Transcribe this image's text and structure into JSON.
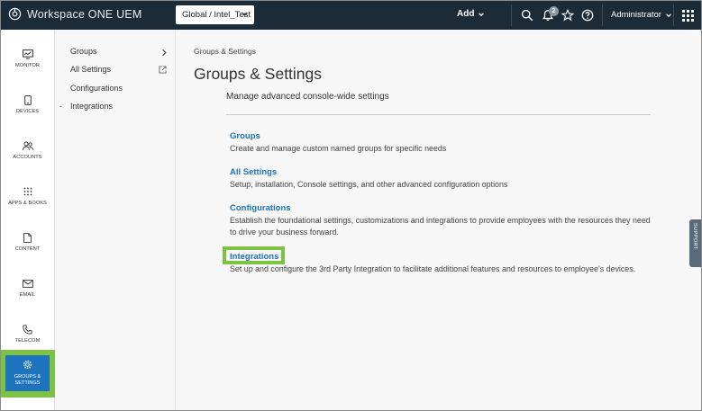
{
  "app": {
    "title": "Workspace ONE UEM"
  },
  "topbar": {
    "org": "Global / Intel_Test",
    "add_label": "Add",
    "notifications_count": "2",
    "user": "Administrator",
    "icons": [
      "search-icon",
      "bell-icon",
      "star-icon",
      "help-icon",
      "apps-grid-icon"
    ]
  },
  "leftnav": {
    "items": [
      {
        "label": "MONITOR",
        "icon": "monitor-icon"
      },
      {
        "label": "DEVICES",
        "icon": "phone-icon"
      },
      {
        "label": "ACCOUNTS",
        "icon": "users-icon"
      },
      {
        "label": "APPS & BOOKS",
        "icon": "apps-grid-icon"
      },
      {
        "label": "CONTENT",
        "icon": "document-icon"
      },
      {
        "label": "EMAIL",
        "icon": "mail-icon"
      },
      {
        "label": "TELECOM",
        "icon": "telephone-icon"
      }
    ],
    "active": {
      "label_line1": "GROUPS &",
      "label_line2": "SETTINGS",
      "icon": "gear-icon"
    }
  },
  "subnav": {
    "items": [
      {
        "label": "Groups"
      },
      {
        "label": "All Settings"
      },
      {
        "label": "Configurations"
      },
      {
        "label": "Integrations",
        "prefix": "-"
      }
    ]
  },
  "main": {
    "breadcrumb": "Groups & Settings",
    "title": "Groups & Settings",
    "subtitle": "Manage advanced console-wide settings",
    "sections": [
      {
        "title": "Groups",
        "desc": "Create and manage custom named groups for specific needs"
      },
      {
        "title": "All Settings",
        "desc": "Setup, installation, Console settings, and other advanced configuration options"
      },
      {
        "title": "Configurations",
        "desc": "Establish the foundational settings, customizations and integrations to provide employees with the resources they need to drive your business forward."
      },
      {
        "title": "Integrations",
        "desc": "Set up and configure the 3rd Party Integration to facilitate additional features and resources to employee's devices."
      }
    ]
  },
  "support_tab": {
    "label": "SUPPORT"
  },
  "colors": {
    "topbar_bg": "#1c2b38",
    "accent_blue": "#1e73be",
    "highlight_green": "#7dc242"
  }
}
